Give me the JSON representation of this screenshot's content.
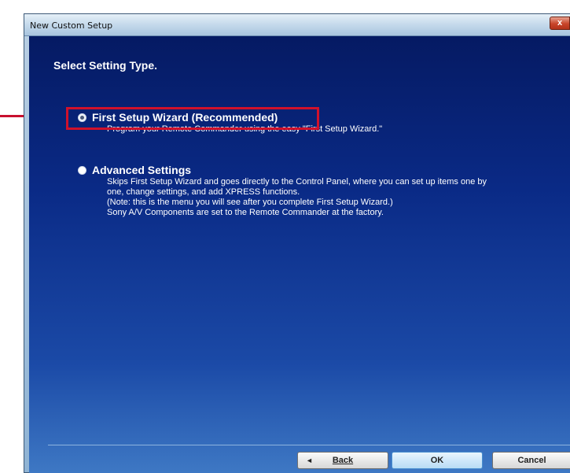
{
  "window": {
    "title": "New Custom Setup",
    "close_label": "x"
  },
  "page": {
    "title": "Select Setting Type."
  },
  "options": [
    {
      "label": "First Setup Wizard (Recommended)",
      "selected": true,
      "description": [
        "Program your Remote Commander using the easy \"First Setup Wizard.\""
      ]
    },
    {
      "label": "Advanced Settings",
      "selected": false,
      "description": [
        "Skips First Setup Wizard and goes directly to the Control Panel, where you can set up items one by",
        "one, change settings, and add XPRESS functions.",
        "(Note: this is the menu you will see after you complete First Setup Wizard.)",
        "Sony A/V Components are set to the Remote Commander at the factory."
      ]
    }
  ],
  "buttons": {
    "back_arrow": "◄",
    "back": "Back",
    "ok": "OK",
    "cancel": "Cancel"
  },
  "colors": {
    "callout": "#c8102e",
    "client_background": "#0a2a86"
  }
}
